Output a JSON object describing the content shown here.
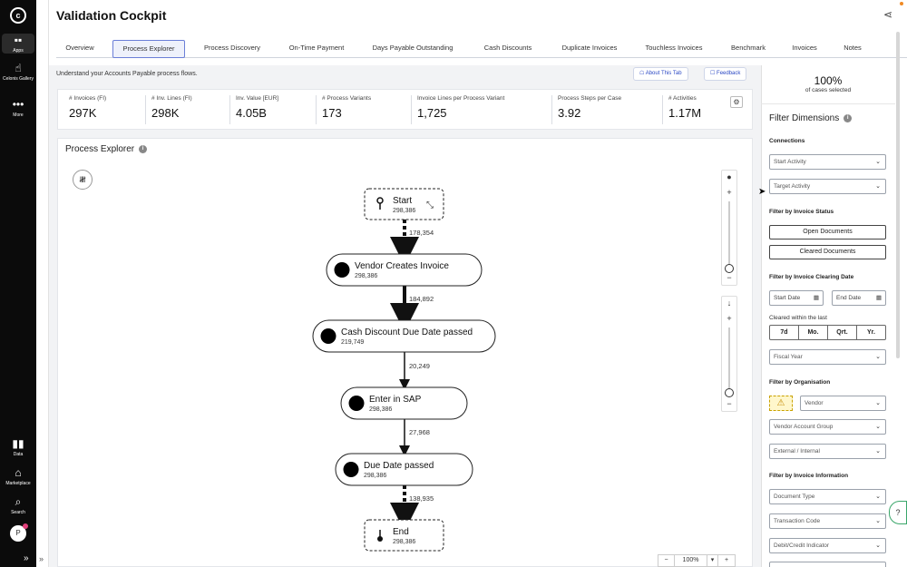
{
  "rail": {
    "items": [
      {
        "icon": "apps-icon",
        "glyph": "▪▪",
        "label": "Apps"
      },
      {
        "icon": "gallery-icon",
        "glyph": "☝",
        "label": "Celonis Gallery"
      },
      {
        "icon": "more-icon",
        "glyph": "•••",
        "label": "More"
      },
      {
        "icon": "data-icon",
        "glyph": "▮▮",
        "label": "Data"
      },
      {
        "icon": "marketplace-icon",
        "glyph": "⌂",
        "label": "Marketplace"
      },
      {
        "icon": "search-icon",
        "glyph": "⌕",
        "label": "Search"
      }
    ],
    "avatar": "P",
    "expand": "»"
  },
  "header": {
    "title": "Validation Cockpit",
    "share_icon": "share-icon",
    "share_glyph": "⋖"
  },
  "tabs": [
    "Overview",
    "Process Explorer",
    "Process Discovery",
    "On-Time Payment",
    "Days Payable Outstanding",
    "Cash Discounts",
    "Duplicate Invoices",
    "Touchless Invoices",
    "Benchmark",
    "Invoices",
    "Notes"
  ],
  "active_tab": "Process Explorer",
  "main": {
    "subtitle": "Understand your Accounts Payable process flows.",
    "about_btn": "About This Tab",
    "feedback_btn": "Feedback"
  },
  "kpis": [
    {
      "label": "# Invoices (FI)",
      "value": "297K"
    },
    {
      "label": "# Inv. Lines (FI)",
      "value": "298K"
    },
    {
      "label": "Inv. Value [EUR]",
      "value": "4.05B"
    },
    {
      "label": "# Process Variants",
      "value": "173"
    },
    {
      "label": "Invoice Lines per Process Variant",
      "value": "1,725"
    },
    {
      "label": "Process Steps per Case",
      "value": "3.92"
    },
    {
      "label": "# Activities",
      "value": "1.17M"
    }
  ],
  "process_explorer": {
    "title": "Process Explorer",
    "zoom": "100%",
    "nodes": [
      {
        "label": "Start",
        "count": "298,386",
        "kind": "start"
      },
      {
        "label": "Vendor Creates Invoice",
        "count": "298,386",
        "kind": "activity"
      },
      {
        "label": "Cash Discount Due Date passed",
        "count": "219,749",
        "kind": "activity"
      },
      {
        "label": "Enter in SAP",
        "count": "298,386",
        "kind": "activity"
      },
      {
        "label": "Due Date passed",
        "count": "298,386",
        "kind": "activity"
      },
      {
        "label": "End",
        "count": "298,386",
        "kind": "end"
      }
    ],
    "edges": [
      "178,354",
      "184,892",
      "20,249",
      "27,968",
      "138,935"
    ]
  },
  "filters": {
    "percent": "100%",
    "percent_sub": "of cases selected",
    "title": "Filter Dimensions",
    "connections": "Connections",
    "start_activity": "Start Activity",
    "target_activity": "Target Activity",
    "by_status": "Filter by Invoice Status",
    "open_docs": "Open Documents",
    "cleared_docs": "Cleared Documents",
    "by_clearing": "Filter by Invoice Clearing Date",
    "start_date": "Start Date",
    "end_date": "End Date",
    "cleared_within": "Cleared within the last",
    "periods": [
      "7d",
      "Mo.",
      "Qrt.",
      "Yr."
    ],
    "fiscal_year": "Fiscal Year",
    "by_org": "Filter by Organisation",
    "vendor": "Vendor",
    "vendor_group": "Vendor Account Group",
    "ext_int": "External / Internal",
    "by_info": "Filter by Invoice Information",
    "doc_type": "Document Type",
    "trans_code": "Transaction Code",
    "debit_credit": "Debit/Credit Indicator"
  }
}
